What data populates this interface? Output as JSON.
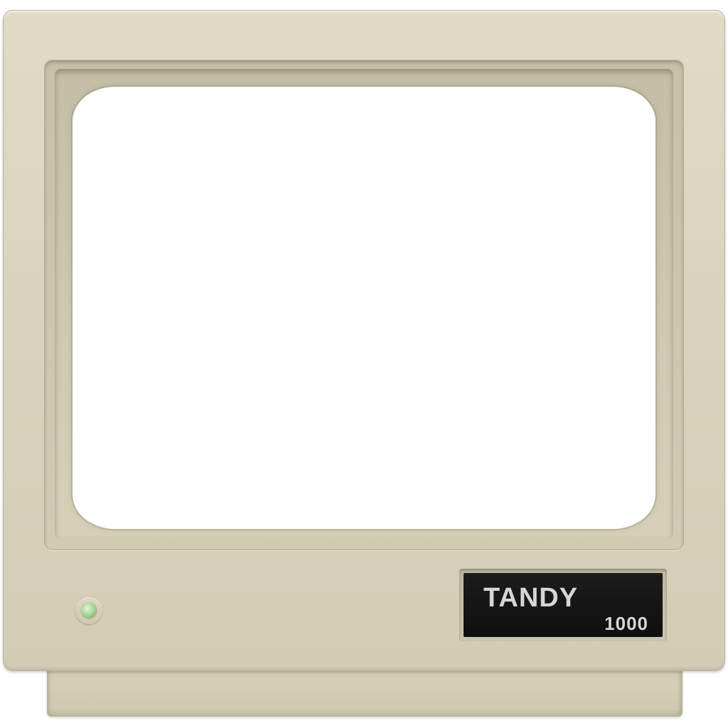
{
  "monitor": {
    "badge": {
      "brand": "TANDY",
      "model": "1000"
    },
    "power_led": {
      "state": "on",
      "color": "#a9d89a"
    },
    "colors": {
      "case": "#d9d2bc",
      "screen": "#ffffff",
      "badge_background": "#141414",
      "badge_text": "#d6d6d6"
    }
  }
}
